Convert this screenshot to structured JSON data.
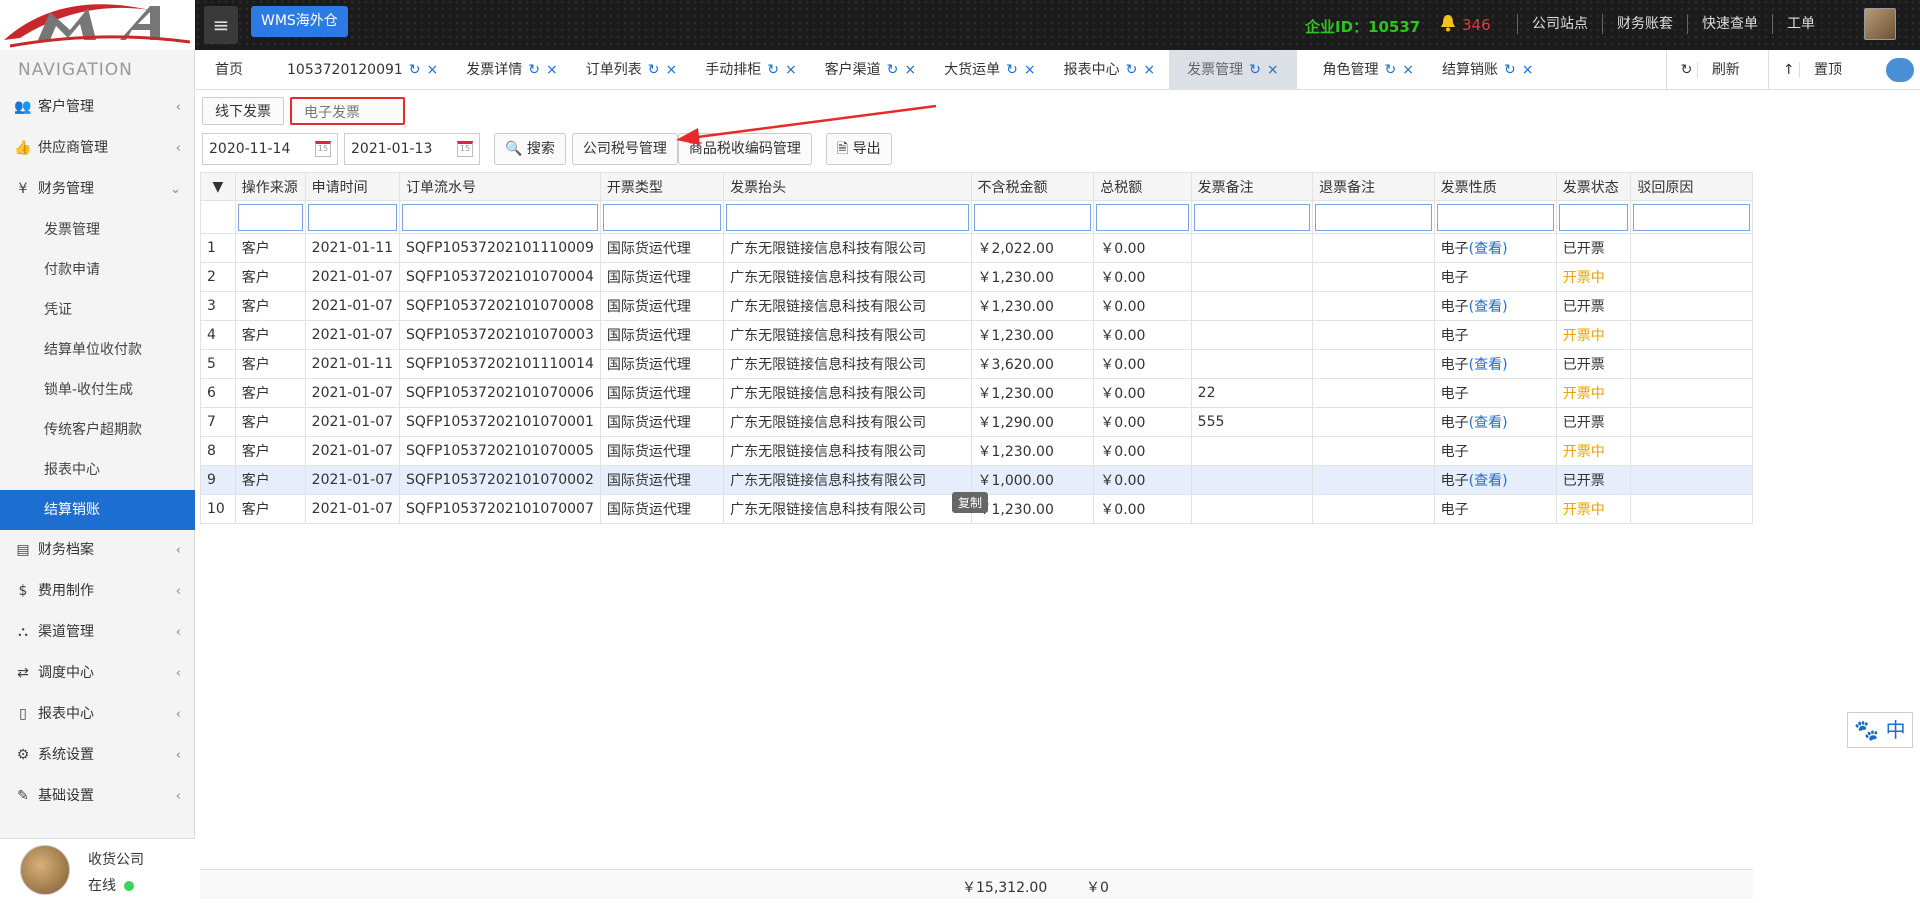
{
  "header": {
    "brand_label": "WMS海外仓",
    "company_id": "企业ID：10537",
    "notification_count": "346",
    "links": [
      "公司站点",
      "财务账套",
      "快速查单",
      "工单"
    ]
  },
  "sidebar": {
    "title": "NAVIGATION",
    "items": [
      {
        "icon": "users-icon",
        "label": "客户管理"
      },
      {
        "icon": "thumbs-up-icon",
        "label": "供应商管理"
      },
      {
        "icon": "yen-icon",
        "label": "财务管理"
      }
    ],
    "sub_items": [
      "发票管理",
      "付款申请",
      "凭证",
      "结算单位收付款",
      "锁单-收付生成",
      "传统客户超期款",
      "报表中心",
      "结算销账"
    ],
    "bottom_items": [
      {
        "icon": "book-icon",
        "label": "财务档案"
      },
      {
        "icon": "dollar-icon",
        "label": "费用制作"
      },
      {
        "icon": "road-icon",
        "label": "渠道管理"
      },
      {
        "icon": "retweet-icon",
        "label": "调度中心"
      },
      {
        "icon": "file-icon",
        "label": "报表中心"
      },
      {
        "icon": "gear-icon",
        "label": "系统设置"
      },
      {
        "icon": "edit-icon",
        "label": "基础设置"
      }
    ],
    "user": {
      "name": "收货公司",
      "status": "在线"
    }
  },
  "tabs": [
    {
      "label": "首页"
    },
    {
      "label": "1053720120091"
    },
    {
      "label": "发票详情"
    },
    {
      "label": "订单列表"
    },
    {
      "label": "手动排柜"
    },
    {
      "label": "客户渠道"
    },
    {
      "label": "大货运单"
    },
    {
      "label": "报表中心"
    },
    {
      "label": "发票管理"
    },
    {
      "label": "角色管理"
    },
    {
      "label": "结算销账"
    }
  ],
  "tab_actions": {
    "refresh": "刷新",
    "top": "置顶"
  },
  "subtabs": [
    "线下发票",
    "电子发票"
  ],
  "toolbar": {
    "date_from": "2020-11-14",
    "date_to": "2021-01-13",
    "search": "搜索",
    "tax_id_mgmt": "公司税号管理",
    "tax_code_mgmt": "商品税收编码管理",
    "export": "导出"
  },
  "table": {
    "columns": [
      "操作来源",
      "申请时间",
      "订单流水号",
      "开票类型",
      "发票抬头",
      "不含税金额",
      "总税额",
      "发票备注",
      "退票备注",
      "发票性质",
      "发票状态",
      "驳回原因"
    ],
    "rows": [
      [
        "1",
        "客户",
        "2021-01-11",
        "SQFP10537202101110009",
        "国际货运代理",
        "广东无限链接信息科技有限公司",
        "￥2,022.00",
        "￥0.00",
        "",
        "",
        "电子",
        "(查看)",
        "已开票"
      ],
      [
        "2",
        "客户",
        "2021-01-07",
        "SQFP10537202101070004",
        "国际货运代理",
        "广东无限链接信息科技有限公司",
        "￥1,230.00",
        "￥0.00",
        "",
        "",
        "电子",
        "",
        "开票中"
      ],
      [
        "3",
        "客户",
        "2021-01-07",
        "SQFP10537202101070008",
        "国际货运代理",
        "广东无限链接信息科技有限公司",
        "￥1,230.00",
        "￥0.00",
        "",
        "",
        "电子",
        "(查看)",
        "已开票"
      ],
      [
        "4",
        "客户",
        "2021-01-07",
        "SQFP10537202101070003",
        "国际货运代理",
        "广东无限链接信息科技有限公司",
        "￥1,230.00",
        "￥0.00",
        "",
        "",
        "电子",
        "",
        "开票中"
      ],
      [
        "5",
        "客户",
        "2021-01-11",
        "SQFP10537202101110014",
        "国际货运代理",
        "广东无限链接信息科技有限公司",
        "￥3,620.00",
        "￥0.00",
        "",
        "",
        "电子",
        "(查看)",
        "已开票"
      ],
      [
        "6",
        "客户",
        "2021-01-07",
        "SQFP10537202101070006",
        "国际货运代理",
        "广东无限链接信息科技有限公司",
        "￥1,230.00",
        "￥0.00",
        "22",
        "",
        "电子",
        "",
        "开票中"
      ],
      [
        "7",
        "客户",
        "2021-01-07",
        "SQFP10537202101070001",
        "国际货运代理",
        "广东无限链接信息科技有限公司",
        "￥1,290.00",
        "￥0.00",
        "555",
        "",
        "电子",
        "(查看)",
        "已开票"
      ],
      [
        "8",
        "客户",
        "2021-01-07",
        "SQFP10537202101070005",
        "国际货运代理",
        "广东无限链接信息科技有限公司",
        "￥1,230.00",
        "￥0.00",
        "",
        "",
        "电子",
        "",
        "开票中"
      ],
      [
        "9",
        "客户",
        "2021-01-07",
        "SQFP10537202101070002",
        "国际货运代理",
        "广东无限链接信息科技有限公司",
        "￥1,000.00",
        "￥0.00",
        "",
        "",
        "电子",
        "(查看)",
        "已开票"
      ],
      [
        "10",
        "客户",
        "2021-01-07",
        "SQFP10537202101070007",
        "国际货运代理",
        "广东无限链接信息科技有限公司",
        "￥1,230.00",
        "￥0.00",
        "",
        "",
        "电子",
        "",
        "开票中"
      ]
    ],
    "selected_row": 9,
    "totals": {
      "amount": "￥15,312.00",
      "tax": "￥0"
    }
  },
  "tooltip": "复制",
  "baidu_widget": "中",
  "colors": {
    "accent": "#1c6ed1",
    "pending": "#f0a200",
    "highlight": "#e62a2a",
    "company_id": "#2fc41c"
  }
}
